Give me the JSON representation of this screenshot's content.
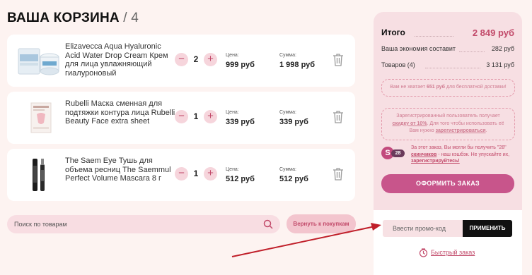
{
  "cart": {
    "title": "ВАША КОРЗИНА",
    "count_text": "/ 4",
    "price_label": "Цена:",
    "sum_label": "Сумма:",
    "items": [
      {
        "name": "Elizavecca Aqua Hyaluronic Acid Water Drop Cream Крем для лица увлажняющий гиалуроновый",
        "qty": "2",
        "price": "999 руб",
        "sum": "1 998 руб"
      },
      {
        "name": "Rubelli Маска сменная для подтяжки контура лица Rubelli Beauty Face extra sheet",
        "qty": "1",
        "price": "339 руб",
        "sum": "339 руб"
      },
      {
        "name": "The Saem Eye Тушь для объема ресниц The Saemmul Perfect Volume Mascara 8 г",
        "qty": "1",
        "price": "512 руб",
        "sum": "512 руб"
      }
    ],
    "minus_symbol": "−",
    "plus_symbol": "+"
  },
  "search": {
    "placeholder": "Поиск по товарам",
    "icon": "search-icon"
  },
  "back_button": "Вернуть к покупкам",
  "summary": {
    "total_label": "Итого",
    "total_value": "2 849 руб",
    "savings_label": "Ваша экономия составит",
    "savings_value": "282 руб",
    "goods_label": "Товаров (4)",
    "goods_value": "3 131 руб"
  },
  "notices": {
    "free_shipping_prefix": "Вам не хватает ",
    "free_shipping_amount": "651 руб",
    "free_shipping_suffix": " для бесплатной доставки!",
    "discount_prefix": "Зарегистрированный пользователь получает ",
    "discount_link": "скидку от 10%",
    "discount_middle": ". Для того чтобы использовать её Вам нужно ",
    "discount_register": "зарегистрироваться",
    "discount_end": "."
  },
  "cashback": {
    "badge": "S",
    "count": "28",
    "text_prefix": "За этот заказ, Вы могли бы получить \"28\" ",
    "text_link": "скинчиков",
    "text_middle": " - наш кэшбэк. Не упускайте их, ",
    "text_register": "зарегистрируйтесь!"
  },
  "order_button": "ОФОРМИТЬ ЗАКАЗ",
  "promo": {
    "placeholder": "Ввести промо-код",
    "apply_label": "ПРИМЕНИТЬ"
  },
  "quick_order": "Быстрый заказ",
  "colors": {
    "accent": "#c24a6a",
    "order_button": "#c8558b",
    "summary_bg": "#f7dfe3",
    "page_bg": "#fdf3f1",
    "arrow": "#c01f2a"
  }
}
